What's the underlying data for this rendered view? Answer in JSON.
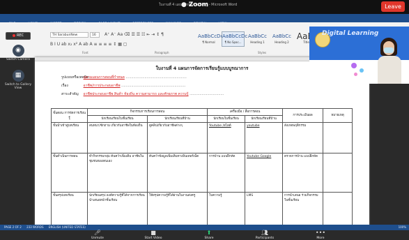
{
  "zoom": {
    "app_name": "Zoom",
    "leave_label": "Leave",
    "window_title": "ใบงานที่ 4 แผนการจัดการเรียนรู้ - Microsoft Word",
    "record_label": "REC",
    "left_tools": [
      {
        "label": "Switch Camera",
        "icon": "camera-icon"
      },
      {
        "label": "Switch to Gallery View",
        "icon": "grid-icon"
      }
    ],
    "controls": [
      {
        "label": "Unmute",
        "icon": "mic-icon"
      },
      {
        "label": "Start Video",
        "icon": "video-icon"
      },
      {
        "label": "Share",
        "icon": "share-icon"
      },
      {
        "label": "Participants",
        "icon": "participants-icon"
      },
      {
        "label": "More",
        "icon": "more-icon"
      }
    ]
  },
  "word": {
    "tabs": [
      "FILE",
      "HOME",
      "INSERT",
      "DESIGN",
      "PAGE LAYOUT",
      "REFERENCES",
      "MAILINGS",
      "REVIEW",
      "VIEW"
    ],
    "font_name": "TH SarabunNew",
    "font_size": "16",
    "tools_row1": "A⁺ A⁻ Aa  ⌫   ☰ ☰ ☷ ⇤ ⇥ ↕ ¶",
    "tools_row2": "B I U ab x₂ x²  A  ab  A     ≡ ≡ ≡ ≡ ↕  ▦ ▢",
    "group_labels": [
      "Font",
      "Paragraph",
      "Styles"
    ],
    "styles": [
      {
        "preview": "AaBbCcDc",
        "name": "¶ Normal",
        "selected": false
      },
      {
        "preview": "AaBbCcDc",
        "name": "¶ No Spac...",
        "selected": true
      },
      {
        "preview": "AaBbCc",
        "name": "Heading 1",
        "selected": false
      },
      {
        "preview": "AaBbCc",
        "name": "Heading 2",
        "selected": false
      },
      {
        "preview": "AaBl",
        "name": "Title",
        "selected": false
      }
    ],
    "status": {
      "page": "PAGE 2 OF 2",
      "words": "233 WORDS",
      "lang": "ENGLISH (UNITED STATES)",
      "zoom": "100%"
    }
  },
  "document": {
    "title": "ใบงานที่ 4 แผนการจัดการเรียนรู้แบบบูรณาการ",
    "fields": [
      {
        "label": "รูปแบบหรือเทคนิค",
        "value": "ดูตามแผนการสอนที่กำหนด",
        "dots": "......................................................."
      },
      {
        "label": "เรื่อง",
        "value": "อาชีพ/การประกอบอาชีพ",
        "dots": ".........................................................."
      },
      {
        "label": "สาระสำคัญ",
        "value": "อาชีพประกอบอาชีพ สินค้า ท้องถิ่น ความสามารถ และศักยภาพ ความรู้",
        "dots": "..............................."
      }
    ],
    "table": {
      "h_steps": "ขั้นตอน การจัดการเรียนรู้",
      "h_activity": "กิจกรรมการเรียนการสอน",
      "h_act_class": "นักเรียนเรียนในชั้นเรียน",
      "h_act_home": "นักเรียนเรียนที่บ้าน",
      "h_tools": "เครื่องมือ / สื่อการสอน",
      "h_tool_class": "นักเรียนในชั้นเรียน",
      "h_tool_home": "นักเรียนเรียนที่บ้าน",
      "h_eval": "การประเมินผล",
      "h_note": "หมายเหตุ",
      "rows": [
        {
          "step": "ขั้นนำเข้าสู่บทเรียน",
          "act_class": "สนทนา/ซักถาม เกี่ยวกับอาชีพในท้องถิ่น",
          "act_home": "ดูคลิปเกี่ยวกับอาชีพต่างๆ",
          "tool_class": "Youtube /สไลด์",
          "tool_home": "youtube",
          "eval": "สังเกตพฤติกรรม",
          "note": ""
        },
        {
          "step": "ขั้นดำเนินการสอน",
          "act_class": "ทำกิจกรรมกลุ่ม ค้นคว้าเพิ่มเติม อาชีพในชุมชนของตนเอง",
          "act_home": "ค้นคว้าข้อมูลเพิ่มเติมทางอินเทอร์เน็ต",
          "tool_class": "การบ้าน แบบฝึกหัด",
          "tool_home": "Youtube Google",
          "eval": "ตรวจการบ้าน แบบฝึกหัด",
          "note": ""
        },
        {
          "step": "ขั้นสรุปบทเรียน",
          "act_class": "นักเรียนสรุป องค์ความรู้ที่ได้จากการเรียน นำเสนอหน้าชั้นเรียน",
          "act_home": "ให้สรุปความรู้ที่ได้ผ่านใบงานส่งครู",
          "tool_class": "ใบความรู้",
          "tool_home": "LMS",
          "eval": "การนำเสนอ ร่วมกิจกรรมในชั้นเรียน",
          "note": ""
        }
      ]
    }
  },
  "webcam": {
    "banner": "Digital Learning"
  }
}
